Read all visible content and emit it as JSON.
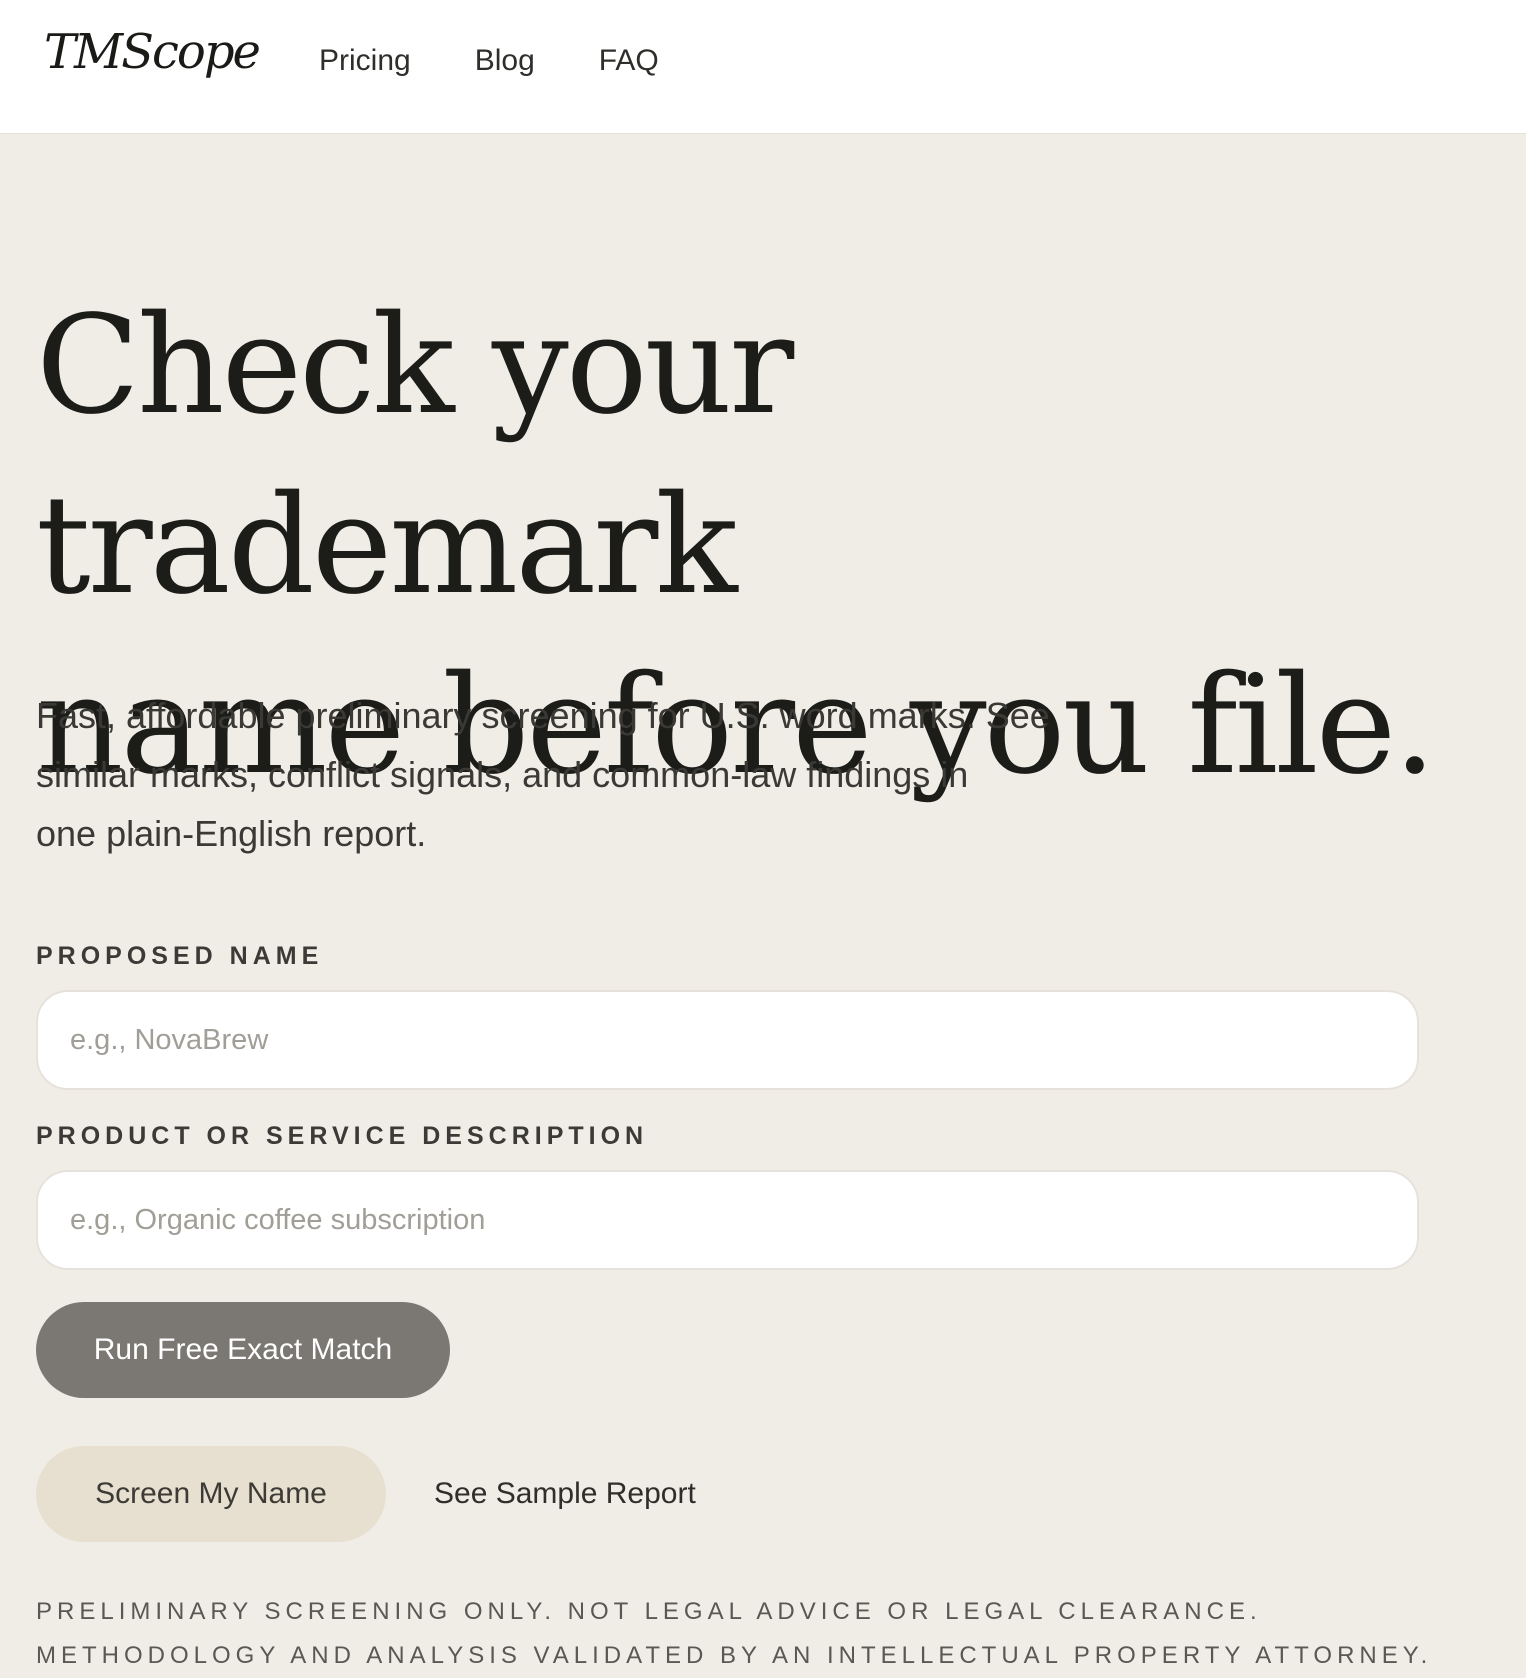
{
  "brand": {
    "logo": "TMScope"
  },
  "nav": {
    "items": [
      "Pricing",
      "Blog",
      "FAQ"
    ]
  },
  "hero": {
    "headline_line1": "Check your trademark",
    "headline_line2": "name before you file.",
    "subtext_line1": "Fast, affordable preliminary screening for U.S. word marks. See",
    "subtext_line2": "similar marks, conflict signals, and common-law findings in",
    "subtext_line3": "one plain-English report."
  },
  "form": {
    "name_label": "PROPOSED NAME",
    "name_placeholder": "e.g., NovaBrew",
    "name_value": "",
    "description_label": "PRODUCT OR SERVICE DESCRIPTION",
    "description_placeholder": "e.g., Organic coffee subscription",
    "description_value": "",
    "primary_button": "Run Free Exact Match",
    "secondary_button": "Screen My Name",
    "sample_link": "See Sample Report"
  },
  "disclaimer": {
    "line1": "PRELIMINARY SCREENING ONLY. NOT LEGAL ADVICE OR LEGAL CLEARANCE.",
    "line2": "METHODOLOGY AND ANALYSIS VALIDATED BY AN INTELLECTUAL PROPERTY ATTORNEY."
  },
  "colors": {
    "page_background": "#f0ede7",
    "header_background": "#ffffff",
    "primary_button": "#7b7874",
    "secondary_button": "#e7e0d1",
    "heading_text": "#1c1c19"
  }
}
